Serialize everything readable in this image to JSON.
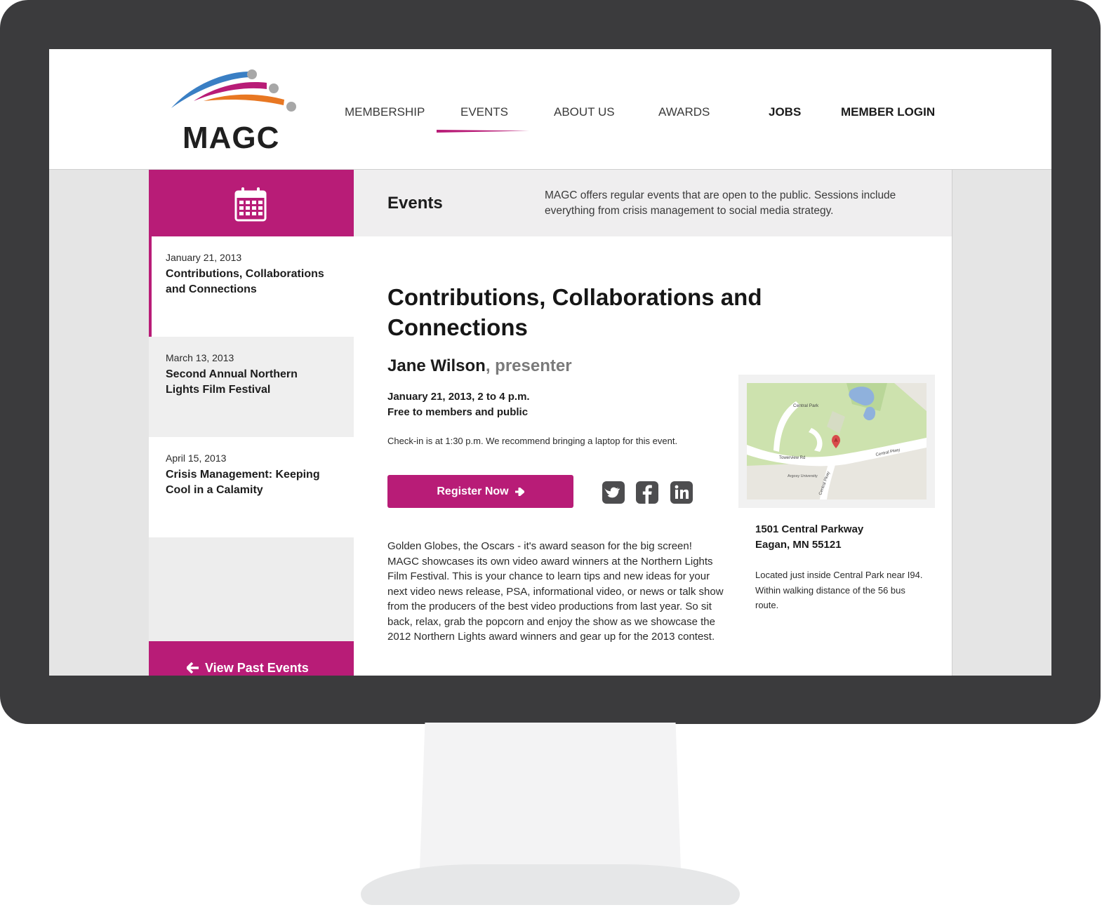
{
  "brand": {
    "name": "MAGC",
    "accent": "#b81c77",
    "logo_colors": [
      "#3a7fc4",
      "#b81c77",
      "#e87722",
      "#a7a7a7"
    ]
  },
  "nav": {
    "items": [
      {
        "label": "MEMBERSHIP",
        "active": false
      },
      {
        "label": "EVENTS",
        "active": true
      },
      {
        "label": "ABOUT US",
        "active": false
      },
      {
        "label": "AWARDS",
        "active": false
      },
      {
        "label": "JOBS",
        "active": false
      },
      {
        "label": "MEMBER LOGIN",
        "active": false
      }
    ]
  },
  "sidebar": {
    "header_icon": "calendar-icon",
    "events": [
      {
        "date": "January 21, 2013",
        "title": "Contributions, Collaborations and Connections",
        "active": true
      },
      {
        "date": "March 13, 2013",
        "title": "Second Annual Northern Lights Film Festival",
        "active": false
      },
      {
        "date": "April 15, 2013",
        "title": "Crisis Management: Keeping Cool in a Calamity",
        "active": false
      }
    ],
    "footer_label": "View Past Events",
    "footer_icon": "arrow-left-icon"
  },
  "content_header": {
    "title": "Events",
    "description": "MAGC offers regular events that are open to the public.  Sessions include everything from crisis management to social media strategy."
  },
  "event": {
    "title": "Contributions, Collaborations and Connections",
    "presenter_name": "Jane Wilson",
    "presenter_role": ", presenter",
    "datetime": "January 21, 2013, 2 to 4 p.m.",
    "price": "Free to members and public",
    "checkin": "Check-in is at 1:30 p.m.  We recommend bringing a laptop for this event.",
    "register_label": "Register Now",
    "register_icon": "arrow-right-icon",
    "social": [
      "twitter-icon",
      "facebook-icon",
      "linkedin-icon"
    ],
    "description": "Golden Globes, the Oscars - it's award season for the big screen! MAGC showcases its own video award winners at the Northern Lights Film Festival. This is your chance to learn tips and new ideas for your next video news release, PSA, informational video, or news or talk show from the producers of the best video productions from last year. So sit back, relax, grab the popcorn and enjoy the show as we showcase the 2012 Northern Lights award winners and gear up for the 2013 contest."
  },
  "location": {
    "map_labels": {
      "park": "Central Park",
      "road1": "Towerview Rd",
      "road2": "Central Pkwy",
      "road3": "Central Pkwy",
      "school": "Argosy University",
      "marker": "A"
    },
    "address_line1": "1501 Central Parkway",
    "address_line2": "Eagan, MN 55121",
    "note": "Located just inside Central Park near I94.  Within walking distance of the 56 bus route."
  }
}
